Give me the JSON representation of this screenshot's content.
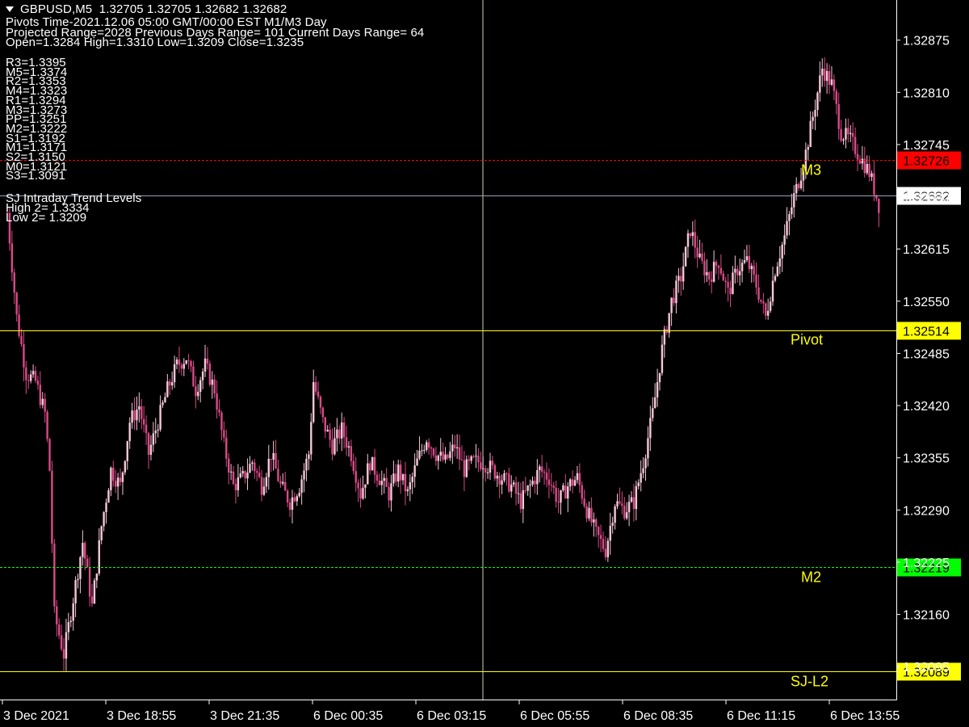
{
  "header": {
    "symbol_line": "GBPUSD,M5  1.32705 1.32705 1.32682 1.32682",
    "pivot_time": "Pivots Time-2021.12.06 05:00 GMT/00:00 EST M1/M3 Day",
    "ranges": "Projected Range=2028 Previous Days Range= 101 Current Days Range= 64",
    "ohlc": "Open=1.3284 High=1.3310 Low=1.3209 Close=1.3235"
  },
  "levels_list": [
    "R3=1.3395",
    "M5=1.3374",
    "R2=1.3353",
    "M4=1.3323",
    "R1=1.3294",
    "M3=1.3273",
    "PP=1.3251",
    "M2=1.3222",
    "S1=1.3192",
    "M1=1.3171",
    "S2=1.3150",
    "M0=1.3121",
    "S3=1.3091"
  ],
  "trend": {
    "title": "SJ Intraday Trend Levels",
    "high": "High 2= 1.3334",
    "low": "Low 2= 1.3209"
  },
  "colors": {
    "background": "#000000",
    "candle": "#d94a87",
    "candle_light": "#f5c8d8",
    "level_yellow": "#ffff00",
    "level_red": "#ff0000",
    "level_green": "#00ff00",
    "current_price_line": "#9aa0b8",
    "axis": "#ffffff",
    "crosshair": "#c8d8b0"
  },
  "chart_data": {
    "type": "candlestick",
    "symbol": "GBPUSD",
    "timeframe": "M5",
    "ylim": [
      1.32054,
      1.32925
    ],
    "y_ticks": [
      1.32875,
      1.3281,
      1.32745,
      1.3268,
      1.32615,
      1.3255,
      1.32485,
      1.3242,
      1.32355,
      1.3229,
      1.32225,
      1.3216,
      1.32095
    ],
    "x_tick_labels": [
      "3 Dec 2021",
      "3 Dec 18:55",
      "3 Dec 21:35",
      "6 Dec 00:35",
      "6 Dec 03:15",
      "6 Dec 05:55",
      "6 Dec 08:35",
      "6 Dec 11:15",
      "6 Dec 13:55"
    ],
    "levels": [
      {
        "label": "M3",
        "price_tag": "1.32726",
        "value": 1.32726,
        "style": "dashed",
        "color": "red"
      },
      {
        "label": "",
        "price_tag": "1.32682",
        "value": 1.32682,
        "style": "solid",
        "color": "current"
      },
      {
        "label": "Pivot",
        "price_tag": "1.32514",
        "value": 1.32514,
        "style": "solid",
        "color": "yellow"
      },
      {
        "label": "M2",
        "price_tag": "1.32219",
        "value": 1.32219,
        "style": "dashed",
        "color": "green"
      },
      {
        "label": "SJ-L2",
        "price_tag": "1.32089",
        "value": 1.32089,
        "style": "solid",
        "color": "yellow"
      }
    ],
    "anchors": [
      [
        0,
        1.3266
      ],
      [
        4,
        1.3253
      ],
      [
        8,
        1.3246
      ],
      [
        12,
        1.3245
      ],
      [
        16,
        1.3241
      ],
      [
        18,
        1.3234
      ],
      [
        20,
        1.3216
      ],
      [
        24,
        1.3211
      ],
      [
        28,
        1.3218
      ],
      [
        32,
        1.3225
      ],
      [
        36,
        1.3217
      ],
      [
        40,
        1.3227
      ],
      [
        44,
        1.3234
      ],
      [
        48,
        1.3232
      ],
      [
        52,
        1.324
      ],
      [
        56,
        1.3242
      ],
      [
        60,
        1.3236
      ],
      [
        64,
        1.324
      ],
      [
        68,
        1.3244
      ],
      [
        72,
        1.3247
      ],
      [
        76,
        1.3248
      ],
      [
        80,
        1.3244
      ],
      [
        84,
        1.3247
      ],
      [
        88,
        1.3244
      ],
      [
        92,
        1.3237
      ],
      [
        96,
        1.3232
      ],
      [
        100,
        1.3233
      ],
      [
        104,
        1.3235
      ],
      [
        108,
        1.3232
      ],
      [
        112,
        1.3236
      ],
      [
        116,
        1.3232
      ],
      [
        120,
        1.323
      ],
      [
        124,
        1.3232
      ],
      [
        128,
        1.3236
      ],
      [
        130,
        1.3245
      ],
      [
        134,
        1.324
      ],
      [
        138,
        1.3237
      ],
      [
        142,
        1.3239
      ],
      [
        146,
        1.3236
      ],
      [
        150,
        1.3231
      ],
      [
        154,
        1.3235
      ],
      [
        158,
        1.3233
      ],
      [
        162,
        1.3231
      ],
      [
        166,
        1.3234
      ],
      [
        170,
        1.3231
      ],
      [
        174,
        1.3235
      ],
      [
        178,
        1.3238
      ],
      [
        182,
        1.3236
      ],
      [
        186,
        1.3235
      ],
      [
        190,
        1.3237
      ],
      [
        194,
        1.3234
      ],
      [
        198,
        1.3235
      ],
      [
        202,
        1.3235
      ],
      [
        206,
        1.3234
      ],
      [
        210,
        1.3233
      ],
      [
        214,
        1.3232
      ],
      [
        218,
        1.323
      ],
      [
        222,
        1.3232
      ],
      [
        226,
        1.3234
      ],
      [
        230,
        1.3233
      ],
      [
        234,
        1.323
      ],
      [
        238,
        1.3232
      ],
      [
        242,
        1.3233
      ],
      [
        246,
        1.3229
      ],
      [
        250,
        1.3226
      ],
      [
        254,
        1.3224
      ],
      [
        258,
        1.323
      ],
      [
        262,
        1.3229
      ],
      [
        266,
        1.323
      ],
      [
        270,
        1.3235
      ],
      [
        274,
        1.3241
      ],
      [
        278,
        1.3249
      ],
      [
        282,
        1.3255
      ],
      [
        286,
        1.3258
      ],
      [
        290,
        1.3264
      ],
      [
        294,
        1.326
      ],
      [
        298,
        1.3258
      ],
      [
        302,
        1.326
      ],
      [
        306,
        1.3256
      ],
      [
        310,
        1.3259
      ],
      [
        314,
        1.326
      ],
      [
        318,
        1.3257
      ],
      [
        322,
        1.3253
      ],
      [
        326,
        1.3259
      ],
      [
        330,
        1.3263
      ],
      [
        334,
        1.3268
      ],
      [
        338,
        1.3272
      ],
      [
        342,
        1.3278
      ],
      [
        346,
        1.3284
      ],
      [
        350,
        1.3282
      ],
      [
        354,
        1.3276
      ],
      [
        358,
        1.3275
      ],
      [
        362,
        1.3273
      ],
      [
        366,
        1.3271
      ],
      [
        370,
        1.3267
      ]
    ]
  }
}
